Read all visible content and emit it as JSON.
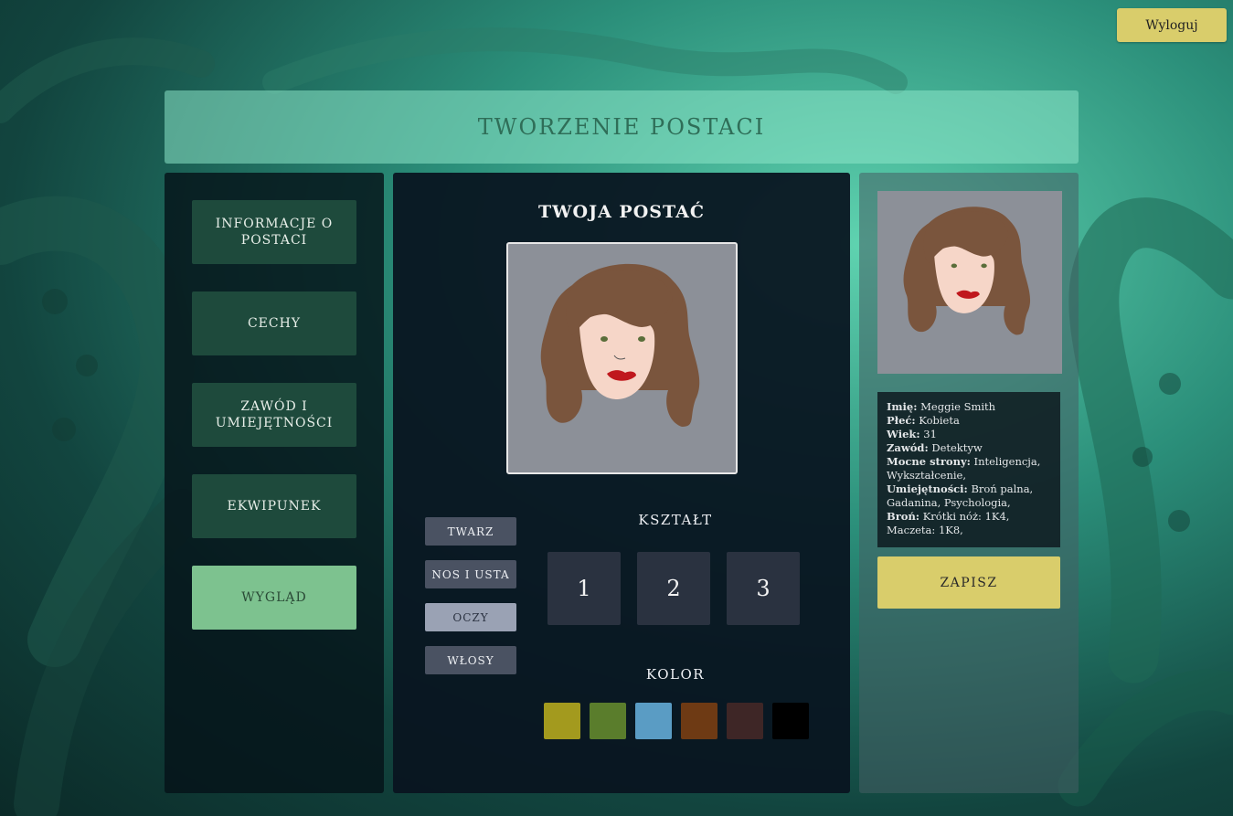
{
  "topbar": {
    "logout_label": "Wyloguj"
  },
  "header": {
    "title": "TWORZENIE POSTACI"
  },
  "sidebar": {
    "items": [
      {
        "label": "INFORMACJE O POSTACI",
        "active": false
      },
      {
        "label": "CECHY",
        "active": false
      },
      {
        "label": "ZAWÓD I UMIEJĘTNOŚCI",
        "active": false
      },
      {
        "label": "EKWIPUNEK",
        "active": false
      },
      {
        "label": "WYGLĄD",
        "active": true
      }
    ]
  },
  "editor": {
    "title": "TWOJA POSTAĆ",
    "categories": [
      {
        "label": "TWARZ",
        "active": false
      },
      {
        "label": "NOS I USTA",
        "active": false
      },
      {
        "label": "OCZY",
        "active": true
      },
      {
        "label": "WŁOSY",
        "active": false
      }
    ],
    "shape_label": "KSZTAŁT",
    "shapes": [
      "1",
      "2",
      "3"
    ],
    "color_label": "KOLOR",
    "colors": [
      "#a39a1e",
      "#5a7d2c",
      "#5a9cc4",
      "#6e3a14",
      "#3e2626",
      "#000000"
    ]
  },
  "summary": {
    "fields": [
      {
        "key": "Imię:",
        "value": "Meggie Smith"
      },
      {
        "key": "Płeć:",
        "value": "Kobieta"
      },
      {
        "key": "Wiek:",
        "value": "31"
      },
      {
        "key": "Zawód:",
        "value": "Detektyw"
      },
      {
        "key": "Mocne strony:",
        "value": "Inteligencja, Wykształcenie,"
      },
      {
        "key": "Umiejętności:",
        "value": "Broń palna, Gadanina, Psychologia,"
      },
      {
        "key": "Broń:",
        "value": "Krótki nóż: 1K4, Maczeta: 1K8,"
      }
    ],
    "save_label": "ZAPISZ"
  },
  "colors": {
    "accent_yellow": "#d9cd6b",
    "nav_dark": "#1e4a3c",
    "nav_active": "#7dc28f",
    "hair": "#7a553d",
    "skin": "#f6d6c8",
    "lips": "#c0181d"
  }
}
